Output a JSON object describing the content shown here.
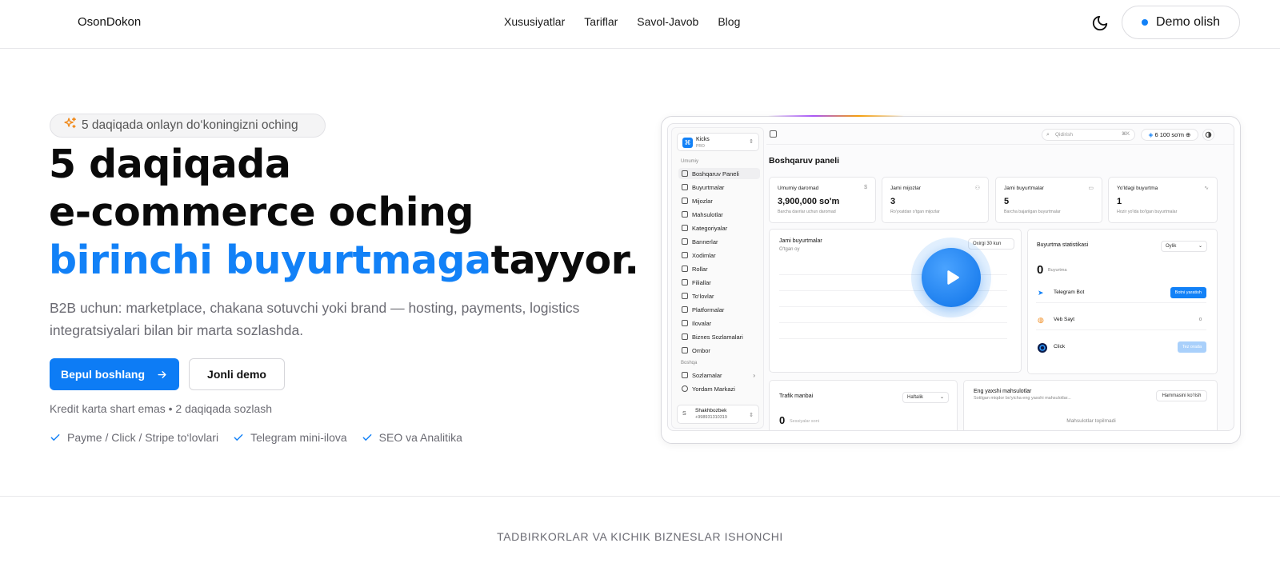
{
  "header": {
    "brand": "OsonDokon",
    "nav": [
      "Xususiyatlar",
      "Tariflar",
      "Savol-Javob",
      "Blog"
    ],
    "theme_icon": "moon-icon",
    "demo_label": "Demo olish"
  },
  "hero": {
    "badge": "5 daqiqada onlayn do‘koningizni oching",
    "badge_icon": "sparkles-icon",
    "headline_line1": "5 daqiqada",
    "headline_line2": "e-commerce oching",
    "headline_line3_blue": "birinchi buyurtmaga",
    "headline_line3_rest": "tayyor.",
    "subtitle": "B2B uchun: marketplace, chakana sotuvchi yoki brand — hosting, payments, logistics integratsiyalari bilan bir marta sozlashda.",
    "primary_cta": "Bepul boshlang",
    "secondary_cta": "Jonli demo",
    "note": "Kredit karta shart emas • 2 daqiqada sozlash",
    "features": [
      "Payme / Click / Stripe to‘lovlari",
      "Telegram mini-ilova",
      "SEO va Analitika"
    ]
  },
  "mockup": {
    "store_name": "Kicks",
    "store_plan": "PRO",
    "section_main": "Umumiy",
    "menu": [
      "Boshqaruv Paneli",
      "Buyurtmalar",
      "Mijozlar",
      "Mahsulotlar",
      "Kategoriyalar",
      "Bannerlar",
      "Xodimlar",
      "Rollar",
      "Filiallar",
      "To‘lovlar",
      "Platformalar",
      "Ilovalar",
      "Biznes Sozlamalari",
      "Ombor"
    ],
    "section_other": "Boshqa",
    "menu_other": [
      "Sozlamalar",
      "Yordam Markazi"
    ],
    "user_initial": "S",
    "user_name": "Shakhbozbek",
    "user_phone": "+998931310319",
    "search_placeholder": "Qidirish",
    "search_kbd": "⌘K",
    "balance": "6 100 so'm",
    "page_title": "Boshqaruv paneli",
    "stats": [
      {
        "label": "Umumiy daromad",
        "value": "3,900,000 so'm",
        "desc": "Barcha davrlar uchun daromad",
        "icon": "$"
      },
      {
        "label": "Jami mijozlar",
        "value": "3",
        "desc": "Ro'yxatdan o'tgan mijozlar",
        "icon": "users-icon"
      },
      {
        "label": "Jami buyurtmalar",
        "value": "5",
        "desc": "Barcha bajarilgan buyurtmalar",
        "icon": "box-icon"
      },
      {
        "label": "Yo'ldagi buyurtma",
        "value": "1",
        "desc": "Hozir yo'lda bo'lgan buyurtmalar",
        "icon": "activity-icon"
      }
    ],
    "orders_chart": {
      "title": "Jami buyurtmalar",
      "subtitle": "O'tgan oy",
      "range": "Oxirgi 30 kun"
    },
    "order_stats": {
      "title": "Buyurtma statistikasi",
      "period": "Oylik",
      "count": "0",
      "count_label": "Buyurtma",
      "rows": [
        {
          "label": "Telegram Bot",
          "action": "Botni yaratish"
        },
        {
          "label": "Veb Sayt",
          "action": "0"
        },
        {
          "label": "Click",
          "action": "Tez orada"
        }
      ]
    },
    "traffic": {
      "title": "Trafik manbai",
      "period": "Haftalik",
      "value": "0",
      "label": "Sessiyalar soni"
    },
    "best_products": {
      "title": "Eng yaxshi mahsulotlar",
      "desc": "Sotilgan miqdor bo'yicha eng yaxshi mahsulotlar...",
      "action": "Hammasini ko'rish",
      "empty": "Mahsulotlar topilmadi"
    }
  },
  "trust_line": "TADBIRKORLAR VA KICHIK BIZNESLAR ISHONCHI",
  "colors": {
    "accent": "#1281f7",
    "text": "#0a0a0a",
    "muted": "#6b6b73"
  }
}
